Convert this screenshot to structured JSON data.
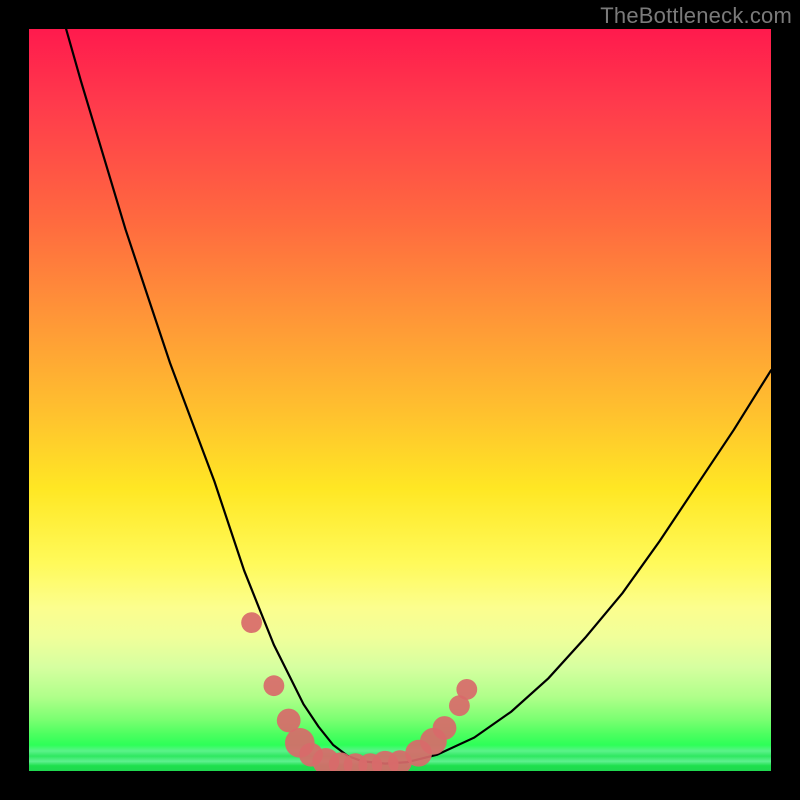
{
  "watermark": "TheBottleneck.com",
  "chart_data": {
    "type": "line",
    "title": "",
    "xlabel": "",
    "ylabel": "",
    "xlim": [
      0,
      100
    ],
    "ylim": [
      0,
      100
    ],
    "grid": false,
    "series": [
      {
        "name": "bottleneck-curve",
        "x": [
          5,
          7,
          10,
          13,
          16,
          19,
          22,
          25,
          27,
          29,
          31,
          33,
          35,
          37,
          39,
          41,
          43,
          45,
          48,
          51,
          55,
          60,
          65,
          70,
          75,
          80,
          85,
          90,
          95,
          100
        ],
        "y": [
          100,
          93,
          83,
          73,
          64,
          55,
          47,
          39,
          33,
          27,
          22,
          17,
          13,
          9,
          6,
          3.5,
          2,
          1.3,
          1,
          1.2,
          2.2,
          4.5,
          8,
          12.5,
          18,
          24,
          31,
          38.5,
          46,
          54
        ]
      }
    ],
    "markers": [
      {
        "x": 30.0,
        "y": 20.0,
        "r": 1.4
      },
      {
        "x": 33.0,
        "y": 11.5,
        "r": 1.4
      },
      {
        "x": 35.0,
        "y": 6.8,
        "r": 1.6
      },
      {
        "x": 36.5,
        "y": 3.8,
        "r": 2.0
      },
      {
        "x": 38.0,
        "y": 2.2,
        "r": 1.6
      },
      {
        "x": 40.0,
        "y": 1.3,
        "r": 1.8
      },
      {
        "x": 42.0,
        "y": 0.9,
        "r": 1.6
      },
      {
        "x": 44.0,
        "y": 0.8,
        "r": 1.6
      },
      {
        "x": 46.0,
        "y": 0.8,
        "r": 1.6
      },
      {
        "x": 48.0,
        "y": 0.9,
        "r": 1.8
      },
      {
        "x": 50.0,
        "y": 1.2,
        "r": 1.6
      },
      {
        "x": 52.5,
        "y": 2.4,
        "r": 1.8
      },
      {
        "x": 54.5,
        "y": 4.0,
        "r": 1.8
      },
      {
        "x": 56.0,
        "y": 5.8,
        "r": 1.6
      },
      {
        "x": 58.0,
        "y": 8.8,
        "r": 1.4
      },
      {
        "x": 59.0,
        "y": 11.0,
        "r": 1.4
      }
    ],
    "marker_color": "#d86a6a",
    "curve_color": "#000000",
    "background_gradient": [
      {
        "stop": 0.0,
        "color": "#ff1a4d"
      },
      {
        "stop": 0.38,
        "color": "#ff9338"
      },
      {
        "stop": 0.62,
        "color": "#ffe724"
      },
      {
        "stop": 0.82,
        "color": "#f0ff9a"
      },
      {
        "stop": 1.0,
        "color": "#20d850"
      }
    ]
  }
}
